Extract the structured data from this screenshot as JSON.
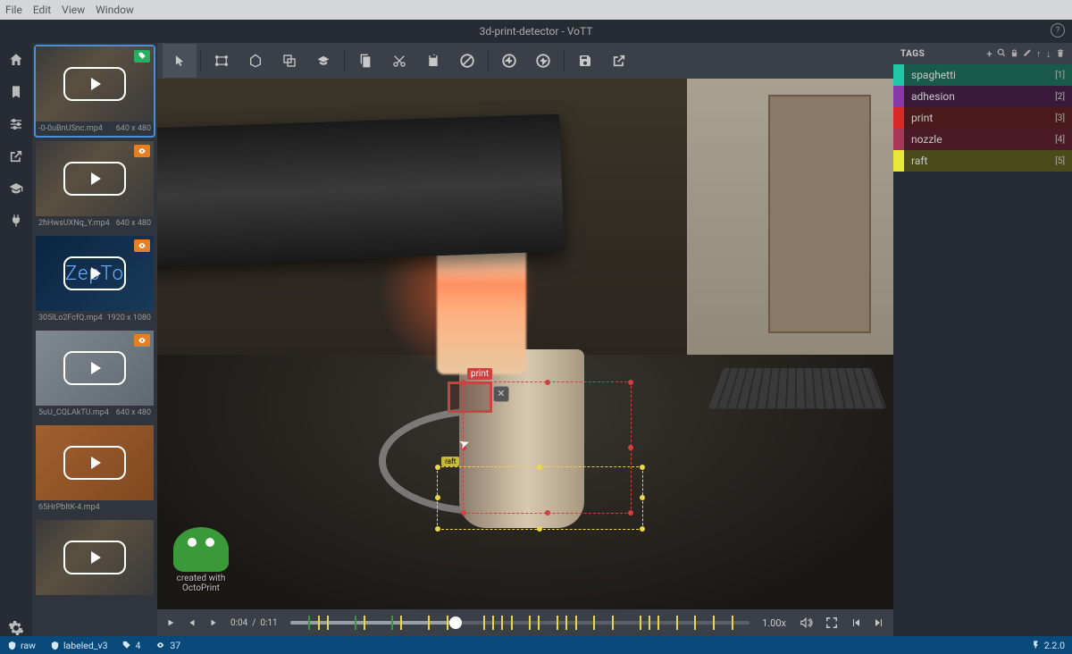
{
  "menubar": {
    "items": [
      "File",
      "Edit",
      "View",
      "Window"
    ]
  },
  "title": "3d-print-detector - VoTT",
  "leftnav": [
    "home",
    "bookmark",
    "sliders",
    "external",
    "grad",
    "plug"
  ],
  "thumbnails": [
    {
      "name": "-0-0uBnUSnc.mp4",
      "res": "640 x 480",
      "badge": "tag",
      "selected": true,
      "style": ""
    },
    {
      "name": "2hHwsUXNq_Y.mp4",
      "res": "640 x 480",
      "badge": "eye",
      "selected": false,
      "style": ""
    },
    {
      "name": "305lLo2FcfQ.mp4",
      "res": "1920 x 1080",
      "badge": "eye",
      "selected": false,
      "style": "zepto",
      "text": "ZepTo"
    },
    {
      "name": "5uU_CQLAkTU.mp4",
      "res": "640 x 480",
      "badge": "eye",
      "selected": false,
      "style": "gray"
    },
    {
      "name": "65HrPbltK-4.mp4",
      "res": "",
      "badge": "",
      "selected": false,
      "style": "orange"
    },
    {
      "name": "",
      "res": "",
      "badge": "",
      "selected": false,
      "style": ""
    }
  ],
  "toolbar": [
    "pointer",
    "rect",
    "polygon",
    "copy-rect",
    "grad",
    "copy",
    "cut",
    "paste",
    "ban",
    "up",
    "down",
    "save",
    "export"
  ],
  "canvas": {
    "annotations": [
      {
        "label": "print",
        "class": "print"
      },
      {
        "label": "raft",
        "class": "raft"
      }
    ],
    "watermark": {
      "line1": "created with",
      "line2": "OctoPrint"
    }
  },
  "player": {
    "current": "0:04",
    "total": "0:11",
    "rate": "1.00x",
    "progress_pct": 36
  },
  "tags": {
    "header": "TAGS",
    "items": [
      {
        "label": "spaghetti",
        "key": "[1]",
        "class": "tag-spaghetti"
      },
      {
        "label": "adhesion",
        "key": "[2]",
        "class": "tag-adhesion"
      },
      {
        "label": "print",
        "key": "[3]",
        "class": "tag-print"
      },
      {
        "label": "nozzle",
        "key": "[4]",
        "class": "tag-nozzle"
      },
      {
        "label": "raft",
        "key": "[5]",
        "class": "tag-raft"
      }
    ]
  },
  "status": {
    "source": "raw",
    "target": "labeled_v3",
    "tagcount": "4",
    "eyecount": "37",
    "version": "2.2.0"
  }
}
